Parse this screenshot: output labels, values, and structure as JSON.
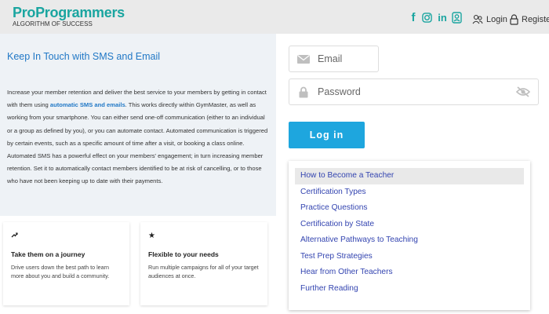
{
  "header": {
    "brand": "ProProgrammers",
    "tagline": "ALGORITHM OF SUCCESS",
    "social_icons": [
      "facebook-icon",
      "instagram-icon",
      "linkedin-icon",
      "badge-icon"
    ],
    "login_label": "Login",
    "register_label": "Register"
  },
  "info": {
    "title": "Keep In Touch with SMS and Email",
    "para_start": "Increase your member retention and deliver the best service to your members by getting in contact with them using ",
    "para_link": "automatic SMS and emails",
    "para_end": ". This works directly within GymMaster, as well as working from your smartphone. You can either send one-off communication (either to an individual or a group as defined by you), or you can automate contact. Automated communication is triggered by certain events, such as a specific amount of time after a visit, or booking a class online. Automated SMS has a powerful effect on your members' engagement; in turn increasing member retention. Set it to automatically contact members identified to be at risk of cancelling, or to those who have not been keeping up to date with their payments."
  },
  "cards": [
    {
      "icon": "trend-icon",
      "title": "Take them on a journey",
      "text": "Drive users down the best path to learn more about you and build a community."
    },
    {
      "icon": "star-icon",
      "title": "Flexible to your needs",
      "text": "Run multiple campaigns for all of your target audiences at once."
    }
  ],
  "login_form": {
    "email_placeholder": "Email",
    "password_placeholder": "Password",
    "submit_label": "Log in"
  },
  "menu": {
    "items": [
      "How to Become a Teacher",
      "Certification Types",
      "Practice Questions",
      "Certification by State",
      "Alternative Pathways to Teaching",
      "Test Prep Strategies",
      "Hear from Other Teachers",
      "Further Reading"
    ],
    "highlighted_index": 0
  },
  "colors": {
    "brand": "#1aa5a0",
    "accent_blue": "#2178c6",
    "button": "#1ea6de",
    "menu_link": "#3344b0"
  }
}
